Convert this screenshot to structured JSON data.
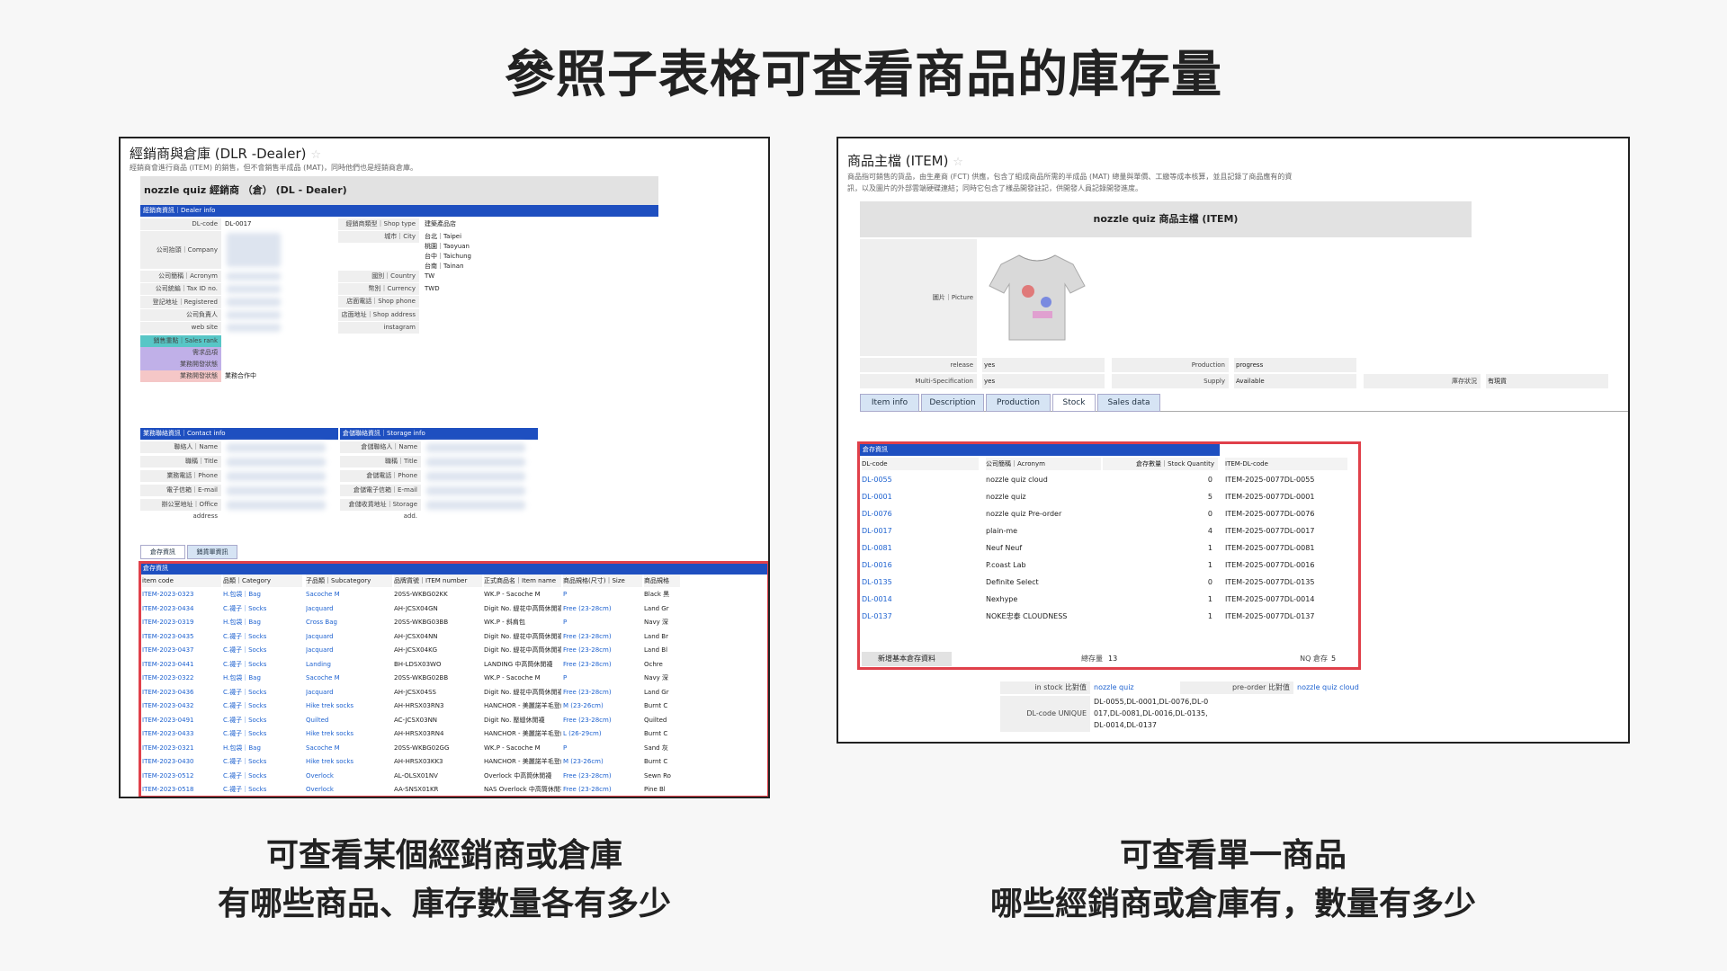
{
  "main_title": "參照子表格可查看商品的庫存量",
  "left_caption": {
    "line1": "可查看某個經銷商或倉庫",
    "line2": "有哪些商品、庫存數量各有多少"
  },
  "right_caption": {
    "line1": "可查看單一商品",
    "line2": "哪些經銷商或倉庫有，數量有多少"
  },
  "dealer": {
    "title": "經銷商與倉庫 (DLR -Dealer)",
    "desc": "經銷商會進行商品 (ITEM) 的銷售，但不會銷售半成品 (MAT)，同時他們也是經銷商倉庫。",
    "sheet_title": "nozzle quiz 經銷商 （倉） (DL - Dealer)",
    "section_info": "經銷商資訊｜Dealer info",
    "fields": [
      {
        "label": "DL-code",
        "value": "DL-0017"
      },
      {
        "label": "公司抬頭｜Company",
        "value": ""
      },
      {
        "label": "公司簡稱｜Acronym",
        "value": ""
      },
      {
        "label": "公司統編｜Tax ID no.",
        "value": ""
      },
      {
        "label": "登記地址｜Registered Address",
        "value": ""
      },
      {
        "label": "公司負責人",
        "value": ""
      },
      {
        "label": "web site",
        "value": ""
      }
    ],
    "right_fields": [
      {
        "label": "經銷商類型｜Shop type",
        "value": "建築產品店"
      },
      {
        "label": "城市｜City",
        "value": "台北｜Taipei"
      },
      {
        "label": "",
        "value": "桃園｜Taoyuan"
      },
      {
        "label": "",
        "value": "台中｜Taichung"
      },
      {
        "label": "",
        "value": "台南｜Tainan"
      },
      {
        "label": "國別｜Country",
        "value": "TW"
      },
      {
        "label": "幣別｜Currency",
        "value": "TWD"
      },
      {
        "label": "店面電話｜Shop phone no.",
        "value": ""
      },
      {
        "label": "店面地址｜Shop address",
        "value": ""
      },
      {
        "label": "instagram",
        "value": ""
      }
    ],
    "rank_fields": [
      {
        "label": "銷售重點｜Sales rank",
        "value": ""
      },
      {
        "label": "需求品項",
        "value": ""
      },
      {
        "label": "業務開發狀態",
        "value": ""
      },
      {
        "label": "業務開發狀態",
        "value": "業務合作中"
      }
    ],
    "section_contact": "業務聯絡資訊｜Contact info",
    "contact_fields": [
      "聯絡人｜Name",
      "職稱｜Title",
      "業務電話｜Phone",
      "電子信箱｜E-mail",
      "辦公室地址｜Office address"
    ],
    "section_storage": "倉儲聯絡資訊｜Storage info",
    "storage_fields": [
      "倉儲聯絡人｜Name",
      "職稱｜Title",
      "倉儲電話｜Phone",
      "倉儲電子信箱｜E-mail",
      "倉儲收貨地址｜Storage add."
    ],
    "tabs": [
      "倉存資訊",
      "銷貨單資訊"
    ],
    "grid_section": "倉存資訊",
    "grid_headers": [
      "item code",
      "品類｜Category",
      "子品類｜Subcategory",
      "品牌貨號｜ITEM number",
      "正式商品名｜Item name",
      "商品規格(尺寸)｜Size",
      "商品規格"
    ],
    "grid_rows": [
      [
        "ITEM-2023-0323",
        "H.包袋｜Bag",
        "Sacoche M",
        "20SS-WKBG02KK",
        "WK.P - Sacoche M",
        "P",
        "Black 黑"
      ],
      [
        "ITEM-2023-0434",
        "C.襪子｜Socks",
        "Jacquard",
        "AH-JCSX04GN",
        "Digit No. 緹花中高筒休閒襪",
        "Free (23-28cm)",
        "Land Gr"
      ],
      [
        "ITEM-2023-0319",
        "H.包袋｜Bag",
        "Cross Bag",
        "20SS-WKBG03BB",
        "WK.P - 斜肩包",
        "P",
        "Navy 深"
      ],
      [
        "ITEM-2023-0435",
        "C.襪子｜Socks",
        "Jacquard",
        "AH-JCSX04NN",
        "Digit No. 緹花中高筒休閒襪",
        "Free (23-28cm)",
        "Land Br"
      ],
      [
        "ITEM-2023-0437",
        "C.襪子｜Socks",
        "Jacquard",
        "AH-JCSX04KG",
        "Digit No. 緹花中高筒休閒襪",
        "Free (23-28cm)",
        "Land Bl"
      ],
      [
        "ITEM-2023-0441",
        "C.襪子｜Socks",
        "Landing",
        "BH-LDSX03WO",
        "LANDING 中高筒休閒襪",
        "Free (23-28cm)",
        "Ochre"
      ],
      [
        "ITEM-2023-0322",
        "H.包袋｜Bag",
        "Sacoche M",
        "20SS-WKBG02BB",
        "WK.P - Sacoche M",
        "P",
        "Navy 深"
      ],
      [
        "ITEM-2023-0436",
        "C.襪子｜Socks",
        "Jacquard",
        "AH-JCSX04SS",
        "Digit No. 緹花中高筒休閒襪",
        "Free (23-28cm)",
        "Land Gr"
      ],
      [
        "ITEM-2023-0432",
        "C.襪子｜Socks",
        "Hike trek socks",
        "AH-HRSX03RN3",
        "HANCHOR - 美麗諾羊毛登山襪",
        "M (23-26cm)",
        "Burnt C"
      ],
      [
        "ITEM-2023-0491",
        "C.襪子｜Socks",
        "Quilted",
        "AC-JCSX03NN",
        "Digit No. 壓縫休閒襪",
        "Free (23-28cm)",
        "Quilted"
      ],
      [
        "ITEM-2023-0433",
        "C.襪子｜Socks",
        "Hike trek socks",
        "AH-HRSX03RN4",
        "HANCHOR - 美麗諾羊毛登山襪",
        "L (26-29cm)",
        "Burnt C"
      ],
      [
        "ITEM-2023-0321",
        "H.包袋｜Bag",
        "Sacoche M",
        "20SS-WKBG02GG",
        "WK.P - Sacoche M",
        "P",
        "Sand 灰"
      ],
      [
        "ITEM-2023-0430",
        "C.襪子｜Socks",
        "Hike trek socks",
        "AH-HRSX03KK3",
        "HANCHOR - 美麗諾羊毛登山襪",
        "M (23-26cm)",
        "Burnt C"
      ],
      [
        "ITEM-2023-0512",
        "C.襪子｜Socks",
        "Overlock",
        "AL-OLSX01NV",
        "Overlock 中高筒休閒襪",
        "Free (23-28cm)",
        "Sewn Ro"
      ],
      [
        "ITEM-2023-0518",
        "C.襪子｜Socks",
        "Overlock",
        "AA-SNSX01KR",
        "NAS Overlock 中高筒休閒襪",
        "Free (23-28cm)",
        "Pine Bl"
      ]
    ]
  },
  "item": {
    "title": "商品主檔 (ITEM)",
    "desc1": "商品指可銷售的貨品，由生產商 (FCT) 供應，包含了組成商品所需的半成品 (MAT) 總量與單價、工繳等成本核算，並且記錄了商品應有的資",
    "desc2": "訊，以及圖片的外部雲端硬碟連結；同時它包含了樣品開發註記，供開發人員記錄開發進度。",
    "sheet_title": "nozzle quiz 商品主檔 (ITEM)",
    "picture_label": "圖片｜Picture",
    "fields": [
      {
        "label": "release",
        "value": "yes"
      },
      {
        "label": "Production",
        "value": "progress"
      },
      {
        "label": "Multi-Specification",
        "value": "yes"
      },
      {
        "label": "Supply",
        "value": "Available"
      },
      {
        "label": "庫存狀況",
        "value": "有現貨"
      }
    ],
    "tabs": [
      "Item info",
      "Description",
      "Production",
      "Stock",
      "Sales data"
    ],
    "stock_section": "倉存資訊",
    "stock_headers": [
      "DL-code",
      "公司簡稱｜Acronym",
      "倉存數量｜Stock Quantity",
      "ITEM-DL-code"
    ],
    "stock_rows": [
      [
        "DL-0055",
        "nozzle quiz cloud",
        "0",
        "ITEM-2025-0077DL-0055"
      ],
      [
        "DL-0001",
        "nozzle quiz",
        "5",
        "ITEM-2025-0077DL-0001"
      ],
      [
        "DL-0076",
        "nozzle quiz Pre-order",
        "0",
        "ITEM-2025-0077DL-0076"
      ],
      [
        "DL-0017",
        "plain-me",
        "4",
        "ITEM-2025-0077DL-0017"
      ],
      [
        "DL-0081",
        "Neuf Neuf",
        "1",
        "ITEM-2025-0077DL-0081"
      ],
      [
        "DL-0016",
        "P.coast Lab",
        "1",
        "ITEM-2025-0077DL-0016"
      ],
      [
        "DL-0135",
        "Definite Select",
        "0",
        "ITEM-2025-0077DL-0135"
      ],
      [
        "DL-0014",
        "Nexhype",
        "1",
        "ITEM-2025-0077DL-0014"
      ],
      [
        "DL-0137",
        "NOKE忠泰 CLOUDNESS",
        "1",
        "ITEM-2025-0077DL-0137"
      ]
    ],
    "add_button": "新增基本倉存資料",
    "total_label": "總存量",
    "total_value": "13",
    "nq_label": "NQ 倉存",
    "nq_value": "5",
    "instock_label": "in stock 比對值",
    "instock_value": "nozzle quiz",
    "preorder_label": "pre-order 比對值",
    "preorder_value": "nozzle quiz cloud",
    "unique_label": "DL-code UNIQUE",
    "unique_value": "DL-0055,DL-0001,DL-0076,DL-0017,DL-0081,DL-0016,DL-0135,DL-0014,DL-0137"
  }
}
